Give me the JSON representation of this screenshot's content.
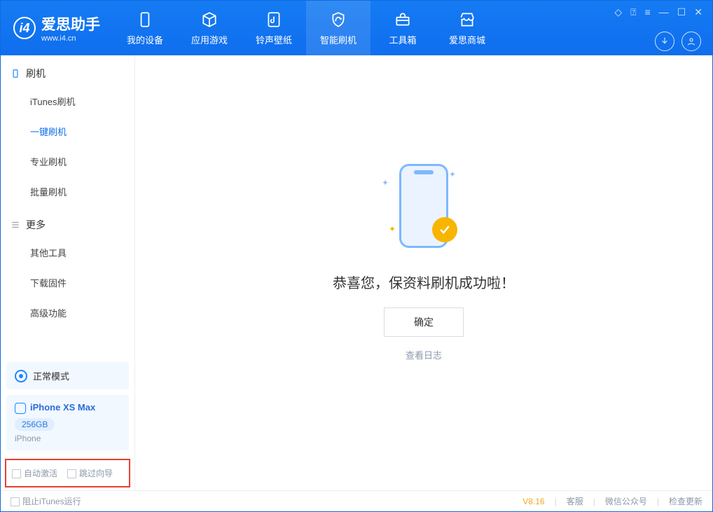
{
  "app": {
    "name": "爱思助手",
    "site": "www.i4.cn"
  },
  "nav": {
    "items": [
      {
        "label": "我的设备"
      },
      {
        "label": "应用游戏"
      },
      {
        "label": "铃声壁纸"
      },
      {
        "label": "智能刷机"
      },
      {
        "label": "工具箱"
      },
      {
        "label": "爱思商城"
      }
    ]
  },
  "sidebar": {
    "group1": {
      "title": "刷机",
      "items": [
        "iTunes刷机",
        "一键刷机",
        "专业刷机",
        "批量刷机"
      ],
      "activeIndex": 1
    },
    "group2": {
      "title": "更多",
      "items": [
        "其他工具",
        "下载固件",
        "高级功能"
      ]
    }
  },
  "mode": {
    "label": "正常模式"
  },
  "device": {
    "name": "iPhone XS Max",
    "capacity": "256GB",
    "type": "iPhone"
  },
  "options": {
    "autoActivate": "自动激活",
    "skipGuide": "跳过向导"
  },
  "main": {
    "message": "恭喜您，保资料刷机成功啦！",
    "okLabel": "确定",
    "logLink": "查看日志"
  },
  "status": {
    "blockItunes": "阻止iTunes运行",
    "version": "V8.16",
    "kefu": "客服",
    "wechat": "微信公众号",
    "update": "检查更新"
  }
}
